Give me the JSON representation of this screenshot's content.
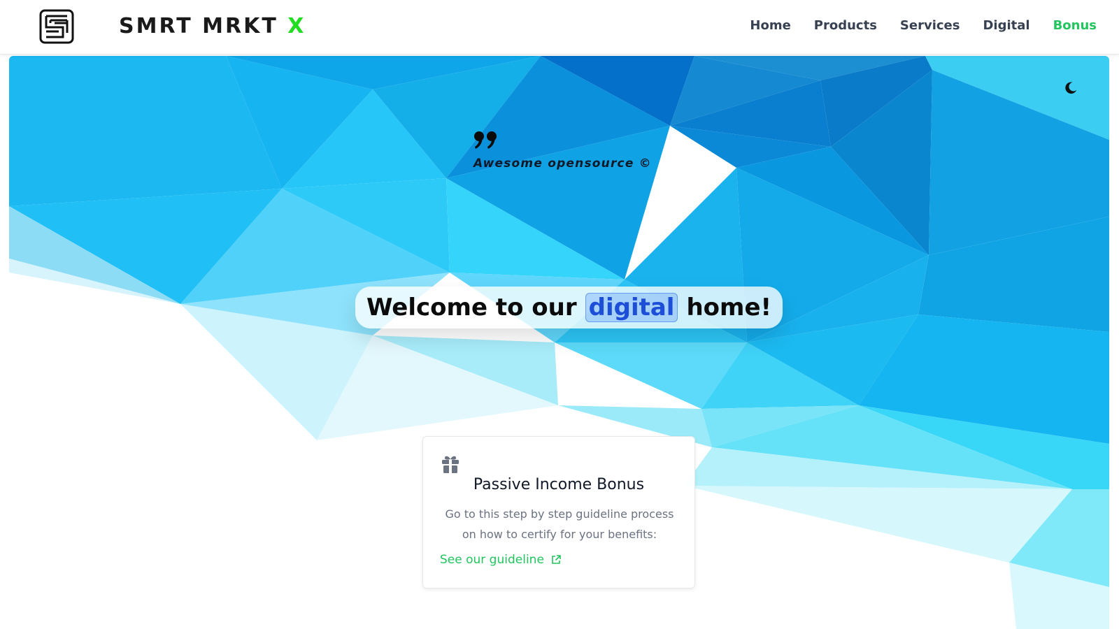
{
  "header": {
    "brand_name": "SMRT MRKT",
    "brand_suffix": "X",
    "nav": [
      {
        "label": "Home"
      },
      {
        "label": "Products"
      },
      {
        "label": "Services"
      },
      {
        "label": "Digital"
      },
      {
        "label": "Bonus",
        "active": true
      }
    ]
  },
  "hero": {
    "quote": "Awesome opensource ©",
    "welcome_before": "Welcome to our",
    "welcome_highlight": "digital",
    "welcome_after": "home!",
    "theme_toggle_icon": "moon-icon"
  },
  "card": {
    "icon": "gift-icon",
    "title": "Passive Income Bonus",
    "description": "Go to this step by step guideline process on how to certify for your benefits:",
    "link_label": "See our guideline",
    "link_icon": "external-link-icon"
  },
  "colors": {
    "accent_green": "#22c55e",
    "brand_x": "#22dd22",
    "highlight_blue": "#1d4ed8",
    "nav_text": "#374151"
  }
}
